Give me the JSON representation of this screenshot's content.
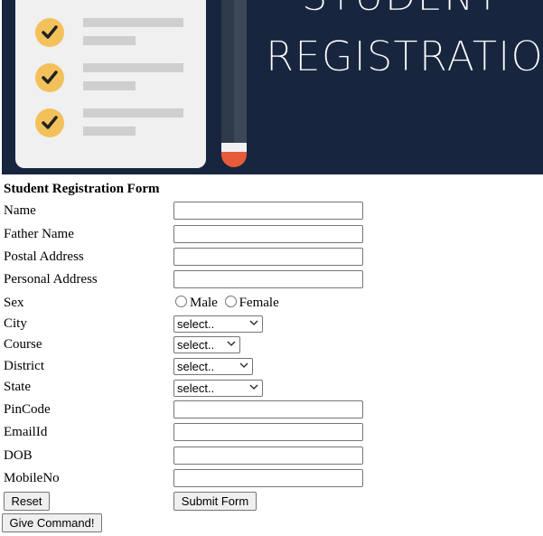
{
  "banner": {
    "title_line1": "STUDENT",
    "title_line2": "REGISTRATION",
    "colors": {
      "background": "#18253f",
      "paper": "#f0f0f0",
      "check": "#f3c15c",
      "pencil_tip": "#e55b3c"
    },
    "checklist_icons": [
      "check-icon",
      "check-icon",
      "check-icon"
    ]
  },
  "form": {
    "heading": "Student Registration Form",
    "labels": {
      "name": "Name",
      "father_name": "Father Name",
      "postal_address": "Postal Address",
      "personal_address": "Personal Address",
      "sex": "Sex",
      "city": "City",
      "course": "Course",
      "district": "District",
      "state": "State",
      "pincode": "PinCode",
      "email": "EmailId",
      "dob": "DOB",
      "mobile": "MobileNo"
    },
    "values": {
      "name": "",
      "father_name": "",
      "postal_address": "",
      "personal_address": "",
      "pincode": "",
      "email": "",
      "dob": "",
      "mobile": ""
    },
    "sex_options": {
      "male": "Male",
      "female": "Female"
    },
    "selects": {
      "city": "select..",
      "course": "select..",
      "district": "select..",
      "state": "select.."
    },
    "buttons": {
      "reset": "Reset",
      "submit": "Submit Form",
      "command": "Give Command!"
    }
  }
}
